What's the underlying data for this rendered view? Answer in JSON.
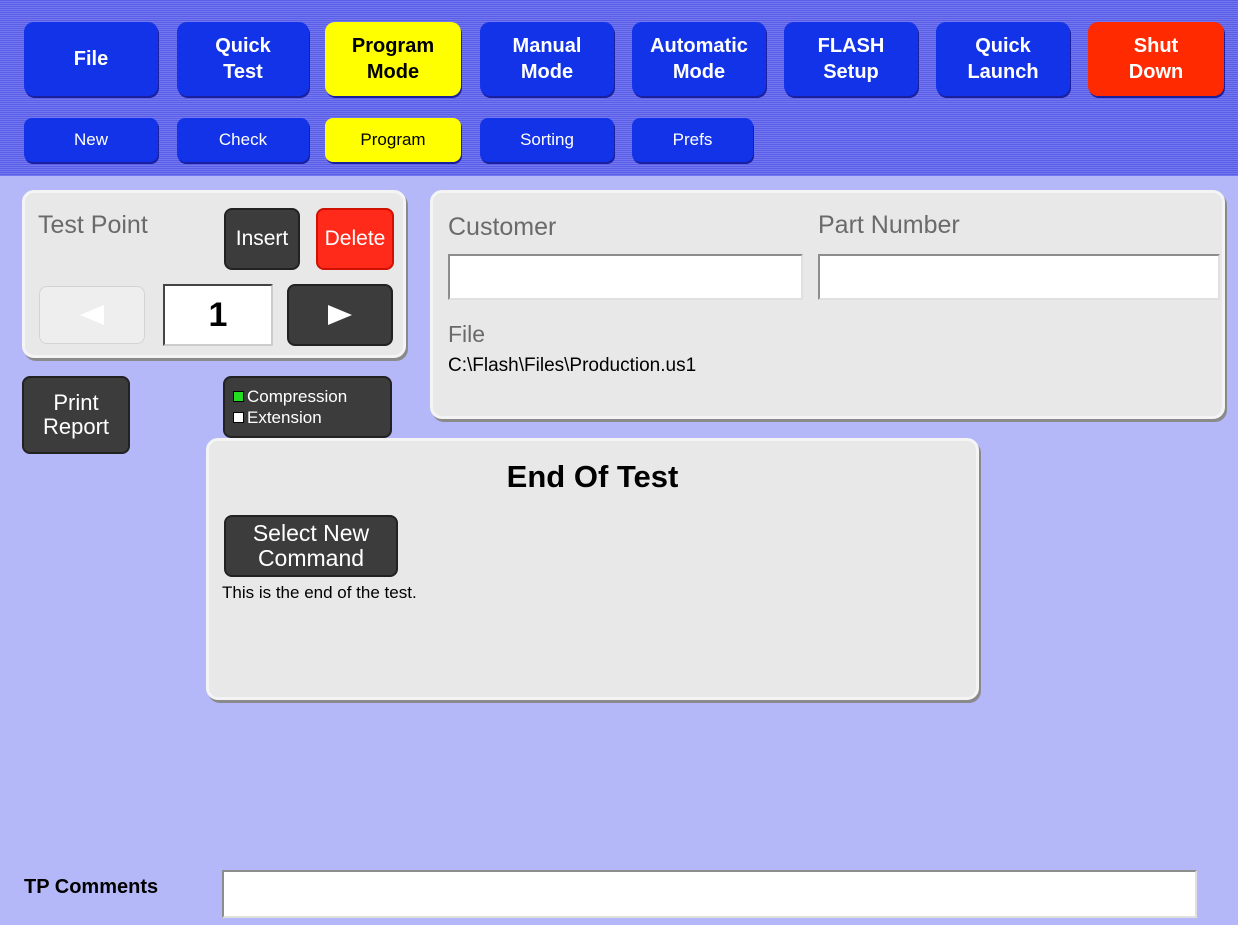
{
  "nav": {
    "main": [
      {
        "label": "File",
        "state": "normal"
      },
      {
        "label": "Quick\nTest",
        "state": "normal"
      },
      {
        "label": "Program\nMode",
        "state": "active"
      },
      {
        "label": "Manual\nMode",
        "state": "normal"
      },
      {
        "label": "Automatic\nMode",
        "state": "normal"
      },
      {
        "label": "FLASH\nSetup",
        "state": "normal"
      },
      {
        "label": "Quick\nLaunch",
        "state": "normal"
      },
      {
        "label": "Shut\nDown",
        "state": "danger"
      }
    ],
    "sub": [
      {
        "label": "New",
        "state": "normal"
      },
      {
        "label": "Check",
        "state": "normal"
      },
      {
        "label": "Program",
        "state": "active"
      },
      {
        "label": "Sorting",
        "state": "normal"
      },
      {
        "label": "Prefs",
        "state": "normal"
      }
    ]
  },
  "test_point": {
    "title": "Test Point",
    "insert_label": "Insert",
    "delete_label": "Delete",
    "prev_icon": "left-arrow-icon",
    "next_icon": "right-arrow-icon",
    "value": "1"
  },
  "print_report_label": "Print\nReport",
  "mode_toggle": {
    "compression_label": "Compression",
    "extension_label": "Extension",
    "compression_color": "#22dd22",
    "extension_color": "#ffffff"
  },
  "info": {
    "customer_label": "Customer",
    "customer_value": "",
    "part_number_label": "Part Number",
    "part_number_value": "",
    "file_label": "File",
    "file_path": "C:\\Flash\\Files\\Production.us1"
  },
  "command": {
    "title": "End Of Test",
    "select_new_label": "Select New\nCommand",
    "description": "This is the end of the test."
  },
  "comments": {
    "label": "TP Comments",
    "value": ""
  },
  "colors": {
    "background": "#b4b8f8",
    "nav_blue": "#1233e8",
    "active_yellow": "#ffff00",
    "danger_red": "#ff2a00",
    "panel_gray": "#e8e8e8"
  }
}
